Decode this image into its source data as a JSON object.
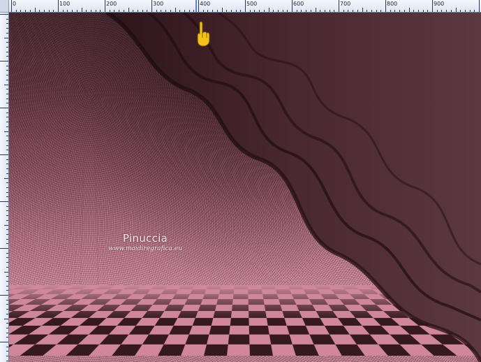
{
  "ruler": {
    "labels": [
      "0",
      "100",
      "200",
      "300",
      "400",
      "500",
      "600",
      "700",
      "800",
      "900"
    ]
  },
  "canvas": {
    "watermark": {
      "name": "Pinuccia",
      "url": "www.maidiregrafica.eu"
    }
  },
  "cursor": {
    "icon": "pointing-hand-icon"
  },
  "colors": {
    "ruler_bg": "#dde5f2",
    "ruler_text": "#1b2440",
    "dark_wave": "#3b1e24",
    "pink_floor": "#cf8799",
    "cursor_yellow": "#f2c21b"
  }
}
